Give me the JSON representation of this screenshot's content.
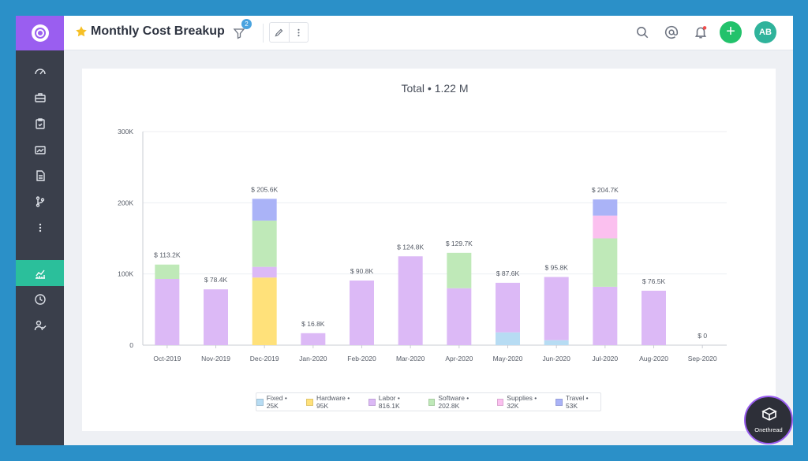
{
  "app": {
    "title": "Monthly Cost Breakup",
    "filter_count": "2",
    "user_initials": "AB",
    "brand_name": "Onethread",
    "accent_color": "#9a5ef0",
    "active_nav_color": "#2bbf9b"
  },
  "sidebar": {
    "items": [
      {
        "icon": "dashboard-gauge-icon"
      },
      {
        "icon": "briefcase-icon"
      },
      {
        "icon": "clipboard-check-icon"
      },
      {
        "icon": "reports-icon"
      },
      {
        "icon": "document-icon"
      },
      {
        "icon": "branch-icon"
      },
      {
        "icon": "more-vertical-icon"
      },
      {
        "icon": "analytics-chart-icon",
        "active": true
      },
      {
        "icon": "clock-icon"
      },
      {
        "icon": "user-check-icon"
      }
    ]
  },
  "toolbar": {
    "icons": [
      "search-icon",
      "at-mention-icon",
      "bell-icon",
      "add-icon"
    ]
  },
  "chart_data": {
    "type": "bar",
    "stacked": true,
    "title": "Total • 1.22 M",
    "categories": [
      "Oct-2019",
      "Nov-2019",
      "Dec-2019",
      "Jan-2020",
      "Feb-2020",
      "Mar-2020",
      "Apr-2020",
      "May-2020",
      "Jun-2020",
      "Jul-2020",
      "Aug-2020",
      "Sep-2020"
    ],
    "totals_labels": [
      "$ 113.2K",
      "$ 78.4K",
      "$ 205.6K",
      "$ 16.8K",
      "$ 90.8K",
      "$ 124.8K",
      "$ 129.7K",
      "$ 87.6K",
      "$ 95.8K",
      "$ 204.7K",
      "$ 76.5K",
      "$ 0"
    ],
    "totals": [
      113.2,
      78.4,
      205.6,
      16.8,
      90.8,
      124.8,
      129.7,
      87.6,
      95.8,
      204.7,
      76.5,
      0
    ],
    "yticks": [
      "0",
      "100K",
      "200K",
      "300K"
    ],
    "ylim": [
      0,
      300
    ],
    "grid": true,
    "legend_placement": "bottom",
    "series": [
      {
        "name": "Fixed",
        "legend": "Fixed • 25K",
        "color": "#b7dcf3",
        "values": [
          0,
          0,
          0,
          0,
          0,
          0,
          0,
          18,
          7,
          0,
          0,
          0
        ]
      },
      {
        "name": "Hardware",
        "legend": "Hardware • 95K",
        "color": "#ffe17a",
        "values": [
          0,
          0,
          95,
          0,
          0,
          0,
          0,
          0,
          0,
          0,
          0,
          0
        ]
      },
      {
        "name": "Labor",
        "legend": "Labor • 816.1K",
        "color": "#dcb9f6",
        "values": [
          93,
          78.4,
          15,
          16.8,
          90.8,
          124.8,
          80,
          69.6,
          88.8,
          82,
          76.5,
          0
        ]
      },
      {
        "name": "Software",
        "legend": "Software • 202.8K",
        "color": "#bfe9b8",
        "values": [
          20.2,
          0,
          65,
          0,
          0,
          0,
          49.7,
          0,
          0,
          68,
          0,
          0
        ]
      },
      {
        "name": "Supplies",
        "legend": "Supplies • 32K",
        "color": "#fbc0ef",
        "values": [
          0,
          0,
          0,
          0,
          0,
          0,
          0,
          0,
          0,
          32,
          0,
          0
        ]
      },
      {
        "name": "Travel",
        "legend": "Travel • 53K",
        "color": "#aab3f7",
        "values": [
          0,
          0,
          30.6,
          0,
          0,
          0,
          0,
          0,
          0,
          22.7,
          0,
          0
        ]
      }
    ]
  }
}
